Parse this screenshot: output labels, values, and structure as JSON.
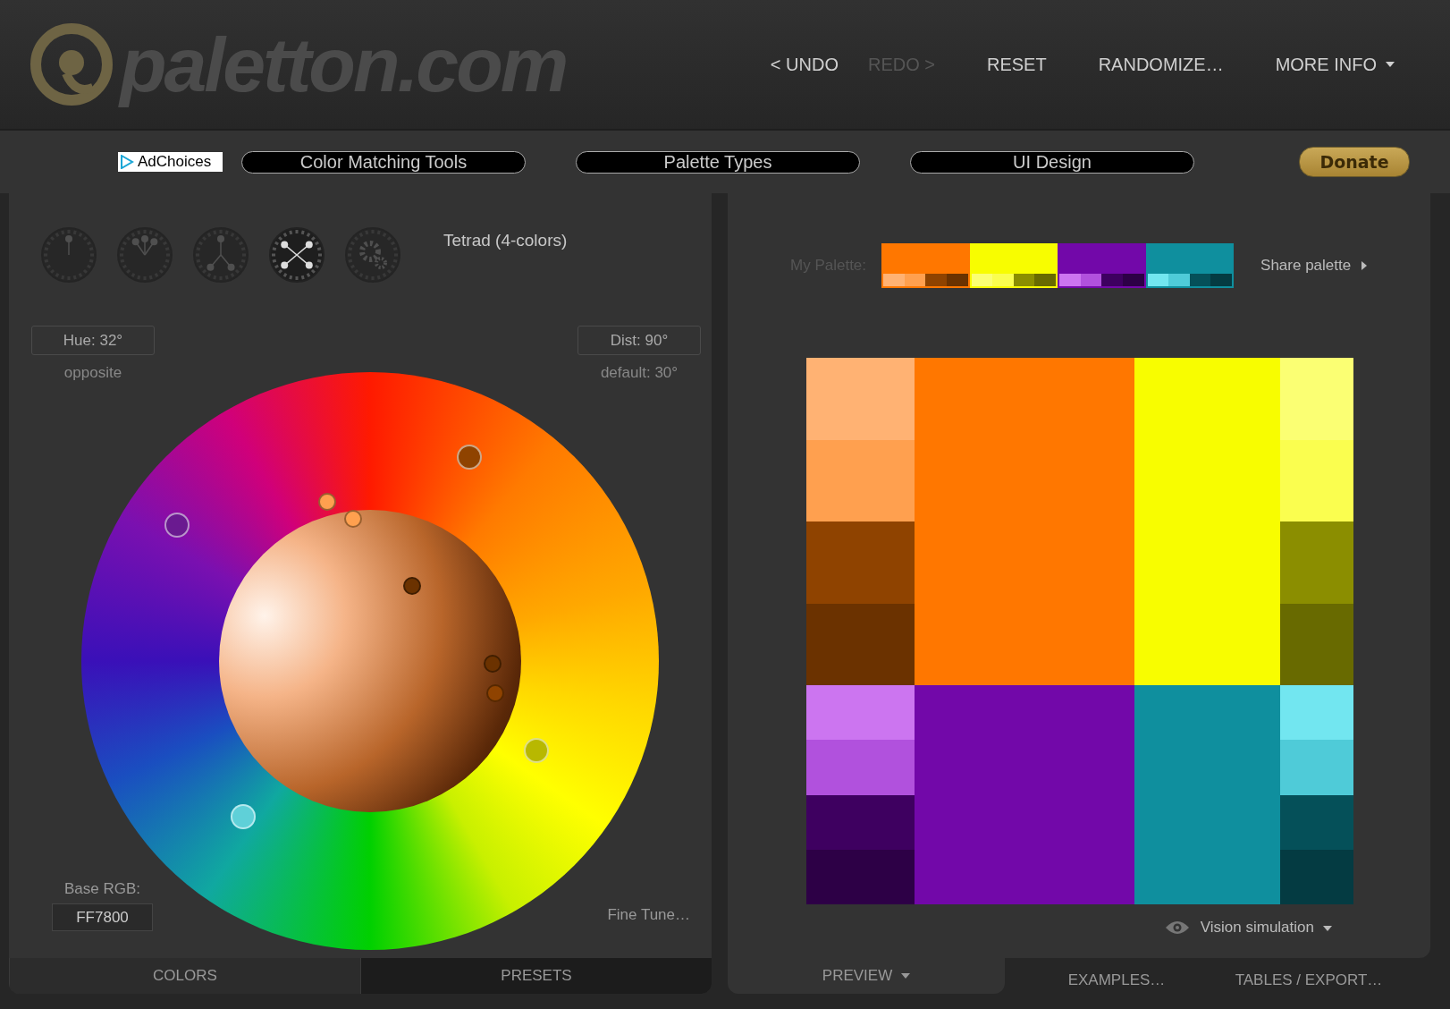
{
  "header": {
    "logo": "paletton.com",
    "nav": [
      {
        "label": "< UNDO",
        "disabled": false
      },
      {
        "label": "REDO >",
        "disabled": true
      },
      {
        "label": "RESET",
        "disabled": false
      },
      {
        "label": "RANDOMIZE…",
        "disabled": false
      },
      {
        "label": "MORE INFO",
        "disabled": false,
        "dropdown": true
      }
    ]
  },
  "toolbar": {
    "ad": "AdChoices",
    "links": [
      "Color Matching Tools",
      "Palette Types",
      "UI Design"
    ],
    "donate": "Donate"
  },
  "colors_panel": {
    "modes": [
      {
        "kind": "mono",
        "selected": false
      },
      {
        "kind": "adjacent",
        "selected": false
      },
      {
        "kind": "triad",
        "selected": false
      },
      {
        "kind": "tetrad",
        "selected": true
      },
      {
        "kind": "free",
        "selected": false
      }
    ],
    "scheme": "Tetrad (4-colors)",
    "hue": "Hue: 32°",
    "hue_hint": "opposite",
    "dist": "Dist: 90°",
    "dist_hint": "default: 30°",
    "base_rgb_label": "Base RGB:",
    "base_rgb": "FF7800",
    "fine_tune": "Fine Tune…",
    "tabs": [
      {
        "label": "COLORS",
        "selected": true
      },
      {
        "label": "PRESETS",
        "selected": false
      }
    ]
  },
  "preview_panel": {
    "my_palette": "My Palette:",
    "share": "Share palette",
    "palette": [
      {
        "color": "#ff7700",
        "shades": [
          {
            "color": "#ffb273"
          },
          {
            "color": "#ffa04f"
          },
          {
            "color": "#8f4300"
          },
          {
            "color": "#6b3200"
          }
        ]
      },
      {
        "color": "#f8fd00",
        "shades": [
          {
            "color": "#fbff73"
          },
          {
            "color": "#fafe4f"
          },
          {
            "color": "#8b8e00"
          },
          {
            "color": "#686a00"
          }
        ]
      },
      {
        "color": "#7208a9",
        "shades": [
          {
            "color": "#cc75f0"
          },
          {
            "color": "#b151dd"
          },
          {
            "color": "#3e0060"
          },
          {
            "color": "#2d0046"
          }
        ]
      },
      {
        "color": "#0f8f9e",
        "shades": [
          {
            "color": "#72e6f0"
          },
          {
            "color": "#4fcbd8"
          },
          {
            "color": "#055059"
          },
          {
            "color": "#043b42"
          }
        ]
      }
    ],
    "vision": "Vision simulation",
    "tabs": [
      {
        "label": "PREVIEW",
        "selected": true,
        "dropdown": true
      },
      {
        "label": "EXAMPLES…",
        "selected": false
      },
      {
        "label": "TABLES / EXPORT…",
        "selected": false
      }
    ]
  }
}
